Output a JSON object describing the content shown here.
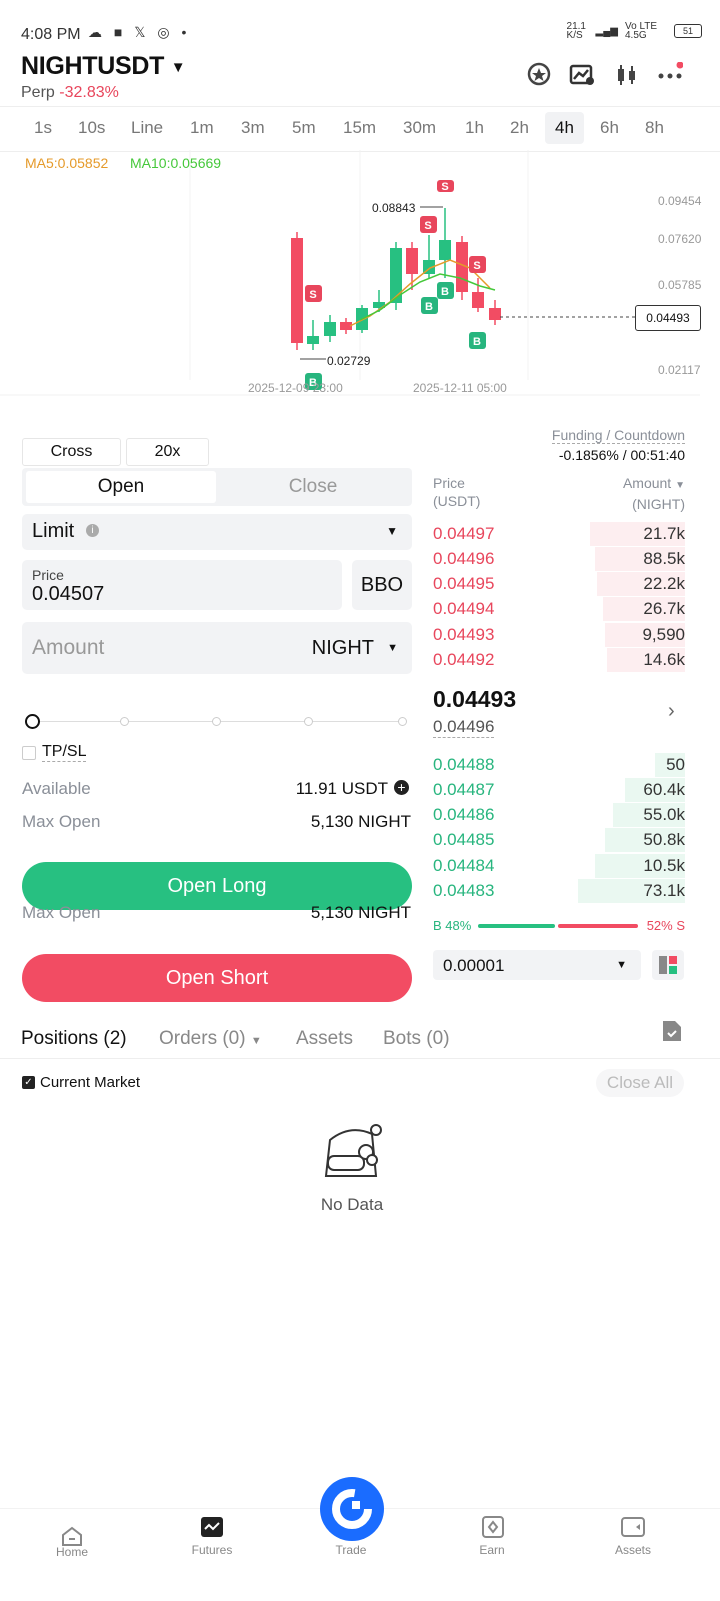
{
  "status": {
    "time": "4:08 PM",
    "net_speed": "21.1 K/S",
    "network": "Vo LTE 4.5G",
    "battery": "51"
  },
  "header": {
    "pair": "NIGHTUSDT",
    "type": "Perp",
    "change": "-32.83%"
  },
  "timeframes": [
    "1s",
    "10s",
    "Line",
    "1m",
    "3m",
    "5m",
    "15m",
    "30m",
    "1h",
    "2h",
    "4h",
    "6h",
    "8h"
  ],
  "active_timeframe": "4h",
  "chart": {
    "ma5": "MA5:0.05852",
    "ma10": "MA10:0.05669",
    "price_labels": [
      "0.09454",
      "0.07620",
      "0.05785",
      "0.04493",
      "0.02117"
    ],
    "current_price_tag": "0.04493",
    "high_label": "0.08843",
    "low_label": "0.02729",
    "date_labels": [
      "2025-12-09 23:00",
      "2025-12-11 05:00"
    ],
    "marker_s": "S",
    "marker_b": "B"
  },
  "form": {
    "margin_mode": "Cross",
    "leverage": "20x",
    "open_tab": "Open",
    "close_tab": "Close",
    "order_type": "Limit",
    "price_label": "Price",
    "price_value": "0.04507",
    "bbo": "BBO",
    "amount_placeholder": "Amount",
    "amount_unit": "NIGHT",
    "tpsl": "TP/SL",
    "available_label": "Available",
    "available_value": "11.91 USDT",
    "max_open_label": "Max Open",
    "max_open_long": "5,130 NIGHT",
    "max_open_short": "5,130 NIGHT",
    "open_long": "Open Long",
    "open_short": "Open Short"
  },
  "orderbook": {
    "funding_label": "Funding / Countdown",
    "funding_value": "-0.1856% / 00:51:40",
    "price_header": "Price",
    "price_unit": "(USDT)",
    "amount_header": "Amount",
    "amount_unit": "(NIGHT)",
    "asks": [
      {
        "price": "0.04497",
        "amount": "21.7k"
      },
      {
        "price": "0.04496",
        "amount": "88.5k"
      },
      {
        "price": "0.04495",
        "amount": "22.2k"
      },
      {
        "price": "0.04494",
        "amount": "26.7k"
      },
      {
        "price": "0.04493",
        "amount": "9,590"
      },
      {
        "price": "0.04492",
        "amount": "14.6k"
      }
    ],
    "last_price": "0.04493",
    "mark_price": "0.04496",
    "bids": [
      {
        "price": "0.04488",
        "amount": "50"
      },
      {
        "price": "0.04487",
        "amount": "60.4k"
      },
      {
        "price": "0.04486",
        "amount": "55.0k"
      },
      {
        "price": "0.04485",
        "amount": "50.8k"
      },
      {
        "price": "0.04484",
        "amount": "10.5k"
      },
      {
        "price": "0.04483",
        "amount": "73.1k"
      }
    ],
    "buy_ratio": "B 48%",
    "sell_ratio": "52% S",
    "precision": "0.00001"
  },
  "positions": {
    "tabs": [
      "Positions (2)",
      "Orders (0)",
      "Assets",
      "Bots (0)"
    ],
    "current_market": "Current Market",
    "close_all": "Close All",
    "empty": "No Data"
  },
  "nav": [
    "Home",
    "Futures",
    "Trade",
    "Earn",
    "Assets"
  ],
  "colors": {
    "green": "#27c081",
    "red": "#f24c63",
    "brand": "#1a6cff"
  }
}
